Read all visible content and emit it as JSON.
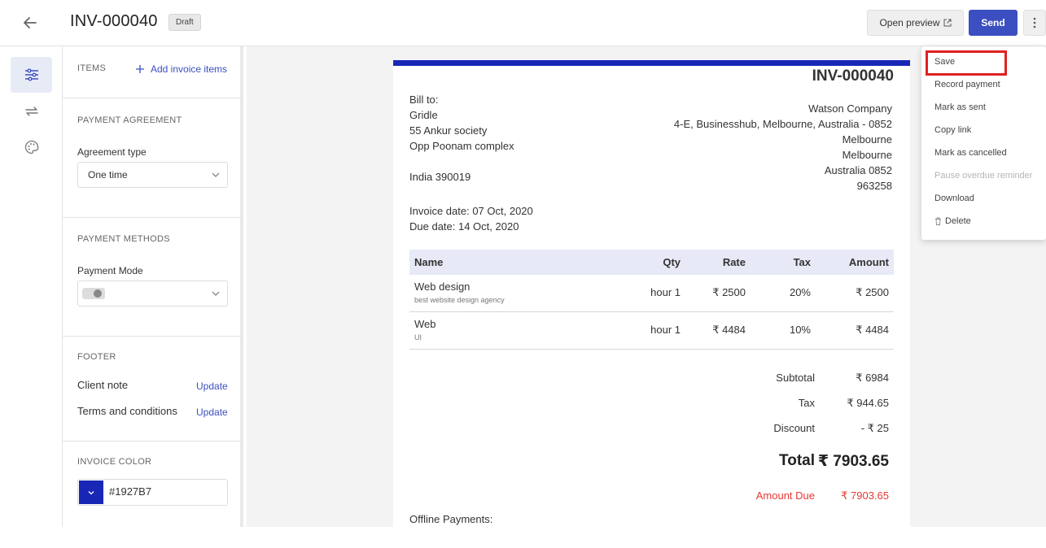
{
  "header": {
    "title": "INV-000040",
    "status_badge": "Draft",
    "preview_label": "Open preview",
    "send_label": "Send"
  },
  "rail": {
    "items": [
      {
        "icon": "settings-sliders-icon",
        "active": true
      },
      {
        "icon": "recurring-arrows-icon",
        "active": false
      },
      {
        "icon": "palette-icon",
        "active": false
      }
    ]
  },
  "panel": {
    "items": {
      "title": "ITEMS",
      "add_link": "Add invoice items"
    },
    "payment_agreement": {
      "title": "PAYMENT AGREEMENT",
      "agreement_label": "Agreement type",
      "agreement_value": "One time"
    },
    "payment_methods": {
      "title": "PAYMENT METHODS",
      "mode_label": "Payment Mode"
    },
    "footer": {
      "title": "FOOTER",
      "client_note_label": "Client note",
      "client_note_link": "Update",
      "terms_label": "Terms and conditions",
      "terms_link": "Update"
    },
    "invoice_color": {
      "title": "INVOICE COLOR",
      "value": "#1927B7"
    }
  },
  "document": {
    "accent_color": "#1927b7",
    "number": "INV-000040",
    "bill_to_label": "Bill to:",
    "bill_to": [
      "Gridle",
      "55 Ankur society",
      "Opp Poonam complex",
      "",
      "India 390019"
    ],
    "company": [
      "Watson Company",
      "4-E, Businesshub, Melbourne, Australia - 0852",
      "Melbourne",
      "Melbourne",
      "Australia 0852",
      "963258"
    ],
    "invoice_date": "Invoice date: 07 Oct, 2020",
    "due_date": "Due date: 14 Oct, 2020",
    "table": {
      "columns": [
        "Name",
        "Qty",
        "Rate",
        "Tax",
        "Amount"
      ],
      "rows": [
        {
          "name": "Web design",
          "desc": "best website design agency",
          "qty": "hour 1",
          "rate": "₹ 2500",
          "tax": "20%",
          "amount": "₹ 2500"
        },
        {
          "name": "Web",
          "desc": "UI",
          "qty": "hour 1",
          "rate": "₹ 4484",
          "tax": "10%",
          "amount": "₹ 4484"
        }
      ]
    },
    "summary": {
      "subtotal_label": "Subtotal",
      "subtotal": "₹ 6984",
      "tax_label": "Tax",
      "tax": "₹ 944.65",
      "discount_label": "Discount",
      "discount": "- ₹ 25",
      "total_label": "Total",
      "total": "₹ 7903.65",
      "due_label": "Amount Due",
      "due": "₹ 7903.65"
    },
    "offline_payments": "Offline Payments:"
  },
  "menu": {
    "items": [
      {
        "label": "Save",
        "disabled": false
      },
      {
        "label": "Record payment",
        "disabled": false
      },
      {
        "label": "Mark as sent",
        "disabled": false
      },
      {
        "label": "Copy link",
        "disabled": false
      },
      {
        "label": "Mark as cancelled",
        "disabled": false
      },
      {
        "label": "Pause overdue reminder",
        "disabled": true
      },
      {
        "label": "Download",
        "disabled": false
      },
      {
        "label": "Delete",
        "disabled": false
      }
    ]
  }
}
